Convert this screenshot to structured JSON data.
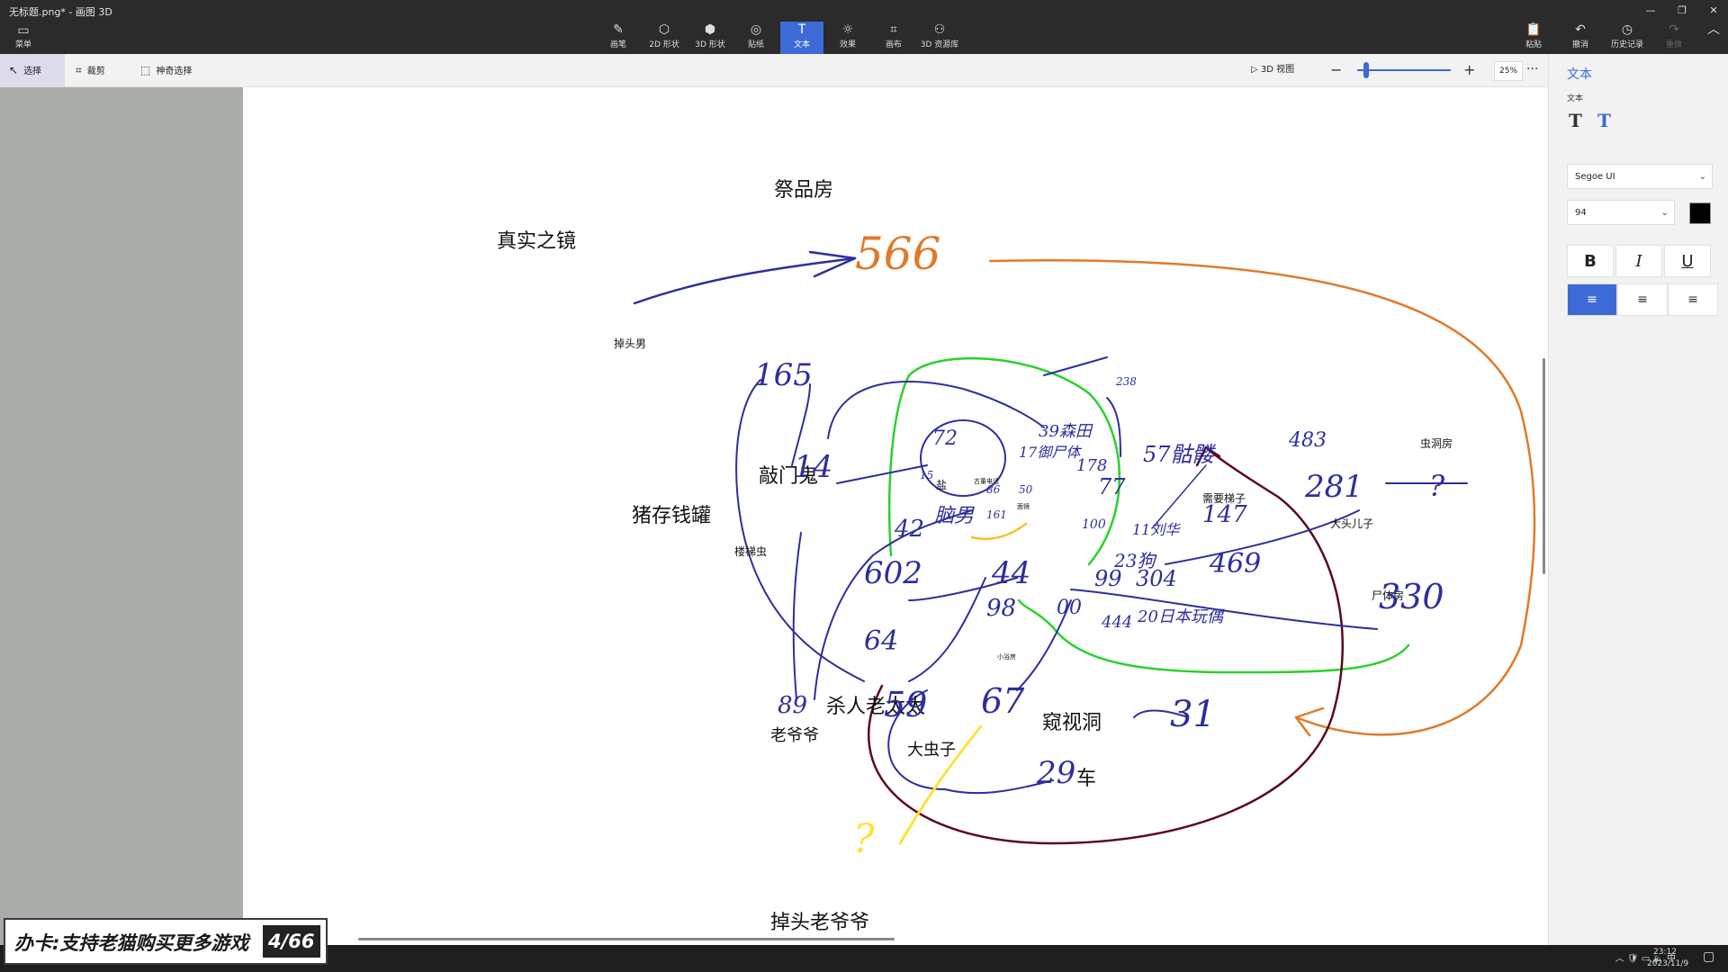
{
  "window": {
    "title": "无标题.png* - 画图 3D",
    "menu_label": "菜单"
  },
  "toolbar": {
    "tools": [
      {
        "label": "画笔",
        "icon": "brush-icon"
      },
      {
        "label": "2D 形状",
        "icon": "shapes-2d-icon"
      },
      {
        "label": "3D 形状",
        "icon": "shapes-3d-icon"
      },
      {
        "label": "贴纸",
        "icon": "sticker-icon"
      },
      {
        "label": "文本",
        "icon": "text-icon"
      },
      {
        "label": "效果",
        "icon": "effects-icon"
      },
      {
        "label": "画布",
        "icon": "canvas-icon"
      },
      {
        "label": "3D 资源库",
        "icon": "library-icon"
      }
    ],
    "active_tool": "文本",
    "right_tools": [
      {
        "label": "粘贴",
        "icon": "paste-icon"
      },
      {
        "label": "撤消",
        "icon": "undo-icon"
      },
      {
        "label": "历史记录",
        "icon": "history-icon"
      },
      {
        "label": "重做",
        "icon": "redo-icon"
      }
    ]
  },
  "subtoolbar": {
    "select_label": "选择",
    "crop_label": "裁剪",
    "magic_select_label": "神奇选择",
    "view3d_label": "3D 视图",
    "zoom": "25%"
  },
  "text_panel": {
    "title": "文本",
    "subtitle": "文本",
    "font": "Segoe UI",
    "size": "94",
    "color": "#000000",
    "bold_label": "B",
    "italic_label": "I",
    "underline_label": "U",
    "alignment": "left"
  },
  "canvas": {
    "labels": {
      "sacrifice_room": "祭品房",
      "true_mirror": "真实之镜",
      "headless_man": "掉头男",
      "knocking_ghost": "敲门鬼",
      "piggy_bank": "猪存钱罐",
      "stair_bug": "楼梯虫",
      "need_ladder": "需要梯子",
      "bug_room": "虫洞房",
      "big_head_son": "大头儿子",
      "corpse_room": "尸体房",
      "killer_granny": "杀人老太太",
      "peep_hole": "窥视洞",
      "big_bug": "大虫子",
      "car": "车",
      "grandpa": "老爷爷",
      "headless_grandpa": "掉头老爷爷",
      "salt": "盐",
      "ancient_phone": "古董电话",
      "mask": "面镜",
      "small_bathroom": "小浴房"
    },
    "numbers": {
      "n566": "566",
      "n165": "165",
      "n14": "14",
      "n72": "72",
      "n238": "238",
      "n39": "39森田",
      "n17": "17御尸体",
      "n178": "178",
      "n57": "57骷髅",
      "n483": "483",
      "n281": "281",
      "n15": "15",
      "n86": "86",
      "n50": "50",
      "n161": "161",
      "n77": "77",
      "n147": "147",
      "n100": "100",
      "n11": "11刘华",
      "n42": "42",
      "n42b": "脑男",
      "n23": "23狗",
      "n602": "602",
      "n44": "44",
      "n99": "99",
      "n304": "304",
      "n469": "469",
      "n330": "330",
      "n98": "98",
      "n00": "00",
      "n444": "444",
      "n20": "20日本玩偶",
      "n64": "64",
      "n89": "89",
      "n59": "59",
      "n67": "67",
      "n31": "31",
      "n29": "29",
      "q1": "?",
      "q2": "?"
    }
  },
  "taskbar": {
    "time": "23:12",
    "date": "2023/11/9",
    "ime": "中"
  },
  "overlay": {
    "text": "办卡:支持老猫购买更多游戏",
    "count": "4/66"
  }
}
